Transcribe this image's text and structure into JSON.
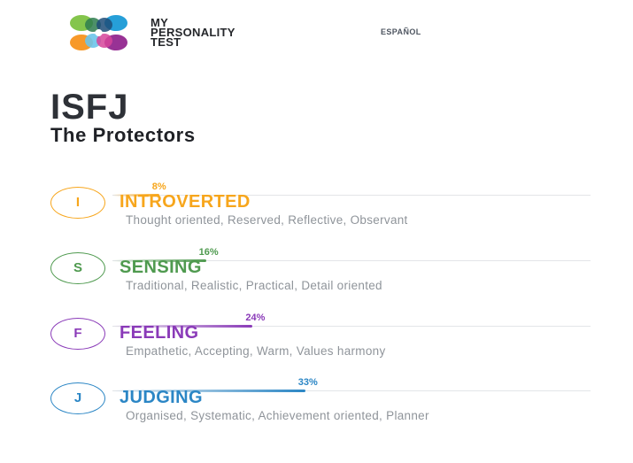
{
  "header": {
    "brand_line1": "MY",
    "brand_line2": "PERSONALITY",
    "brand_line3": "TEST",
    "language_link": "ESPAÑOL"
  },
  "result": {
    "code": "ISFJ",
    "name": "The Protectors"
  },
  "traits": [
    {
      "letter": "I",
      "title": "INTROVERTED",
      "percent": "8%",
      "percent_value": 8,
      "description": "Thought oriented, Reserved, Reflective, Observant",
      "color": "#f7a61c"
    },
    {
      "letter": "S",
      "title": "SENSING",
      "percent": "16%",
      "percent_value": 16,
      "description": "Traditional, Realistic, Practical, Detail oriented",
      "color": "#4f9a4f"
    },
    {
      "letter": "F",
      "title": "FEELING",
      "percent": "24%",
      "percent_value": 24,
      "description": "Empathetic, Accepting, Warm, Values harmony",
      "color": "#8a3ab8"
    },
    {
      "letter": "J",
      "title": "JUDGING",
      "percent": "33%",
      "percent_value": 33,
      "description": "Organised, Systematic, Achievement oriented, Planner",
      "color": "#2b86c5"
    }
  ],
  "colors": {
    "text_dark": "#2e3137",
    "text_muted": "#8f949a",
    "logo_green": "#7dc242",
    "logo_blue": "#1a9ad6",
    "logo_orange": "#f7941d",
    "logo_purple": "#92278f",
    "logo_dark_green": "#2e7d4f",
    "logo_navy": "#1f4e79"
  }
}
